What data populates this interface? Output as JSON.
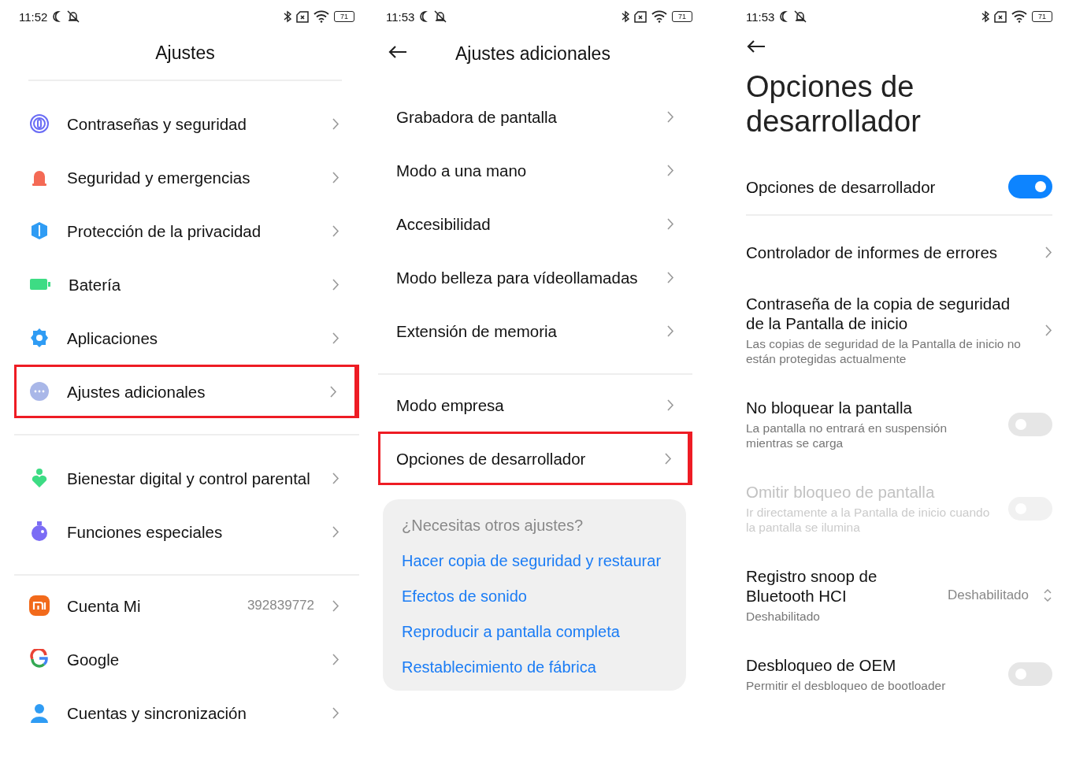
{
  "screens": [
    {
      "kind": "list",
      "status": {
        "time": "11:52",
        "battery": "71"
      },
      "title": "Ajustes",
      "back": false,
      "groups": [
        [
          {
            "label": "Contraseñas y seguridad",
            "highlighted": false
          },
          {
            "label": "Seguridad y emergencias",
            "highlighted": false
          },
          {
            "label": "Protección de la privacidad",
            "highlighted": false
          },
          {
            "label": "Batería",
            "highlighted": false
          },
          {
            "label": "Aplicaciones",
            "highlighted": false
          },
          {
            "label": "Ajustes adicionales",
            "highlighted": true
          }
        ],
        [
          {
            "label": "Bienestar digital y control parental",
            "highlighted": false
          },
          {
            "label": "Funciones especiales",
            "highlighted": false
          }
        ],
        [
          {
            "label": "Cuenta Mi",
            "value": "392839772",
            "highlighted": false
          },
          {
            "label": "Google",
            "highlighted": false
          },
          {
            "label": "Cuentas y sincronización",
            "highlighted": false
          }
        ]
      ]
    },
    {
      "kind": "list",
      "status": {
        "time": "11:53",
        "battery": "71"
      },
      "title": "Ajustes adicionales",
      "back": true,
      "groups": [
        [
          {
            "label": "Grabadora de pantalla",
            "highlighted": false
          },
          {
            "label": "Modo a una mano",
            "highlighted": false
          },
          {
            "label": "Accesibilidad",
            "highlighted": false
          },
          {
            "label": "Modo belleza para vídeollamadas",
            "highlighted": false
          },
          {
            "label": "Extensión de memoria",
            "highlighted": false
          }
        ],
        [
          {
            "label": "Modo empresa",
            "highlighted": false
          },
          {
            "label": "Opciones de desarrollador",
            "highlighted": true
          }
        ]
      ],
      "suggestions": {
        "heading": "¿Necesitas otros ajustes?",
        "links": [
          "Hacer copia de seguridad y restaurar",
          "Efectos de sonido",
          "Reproducir a pantalla completa",
          "Restablecimiento de fábrica"
        ]
      }
    },
    {
      "kind": "developer",
      "status": {
        "time": "11:53",
        "battery": "71"
      },
      "title": "Opciones de desarrollador",
      "back": true,
      "master": {
        "label": "Opciones de desarrollador",
        "on": true
      },
      "rows": [
        {
          "kind": "link",
          "label": "Controlador de informes de errores",
          "disabled": false
        },
        {
          "kind": "link",
          "label": "Contraseña de la copia de seguridad de la Pantalla de inicio",
          "description": "Las copias de seguridad de la Pantalla de inicio no están protegidas actualmente",
          "disabled": false
        },
        {
          "kind": "toggle",
          "label": "No bloquear la pantalla",
          "description": "La pantalla no entrará en suspensión mientras se carga",
          "on": false,
          "disabled": false
        },
        {
          "kind": "toggle",
          "label": "Omitir bloqueo de pantalla",
          "description": "Ir directamente a la Pantalla de inicio cuando la pantalla se ilumina",
          "on": false,
          "disabled": true
        },
        {
          "kind": "select",
          "label": "Registro snoop de Bluetooth HCI",
          "description": "Deshabilitado",
          "value": "Deshabilitado",
          "disabled": false
        },
        {
          "kind": "toggle",
          "label": "Desbloqueo de OEM",
          "description": "Permitir el desbloqueo de bootloader",
          "on": false,
          "disabled": false
        }
      ]
    }
  ]
}
